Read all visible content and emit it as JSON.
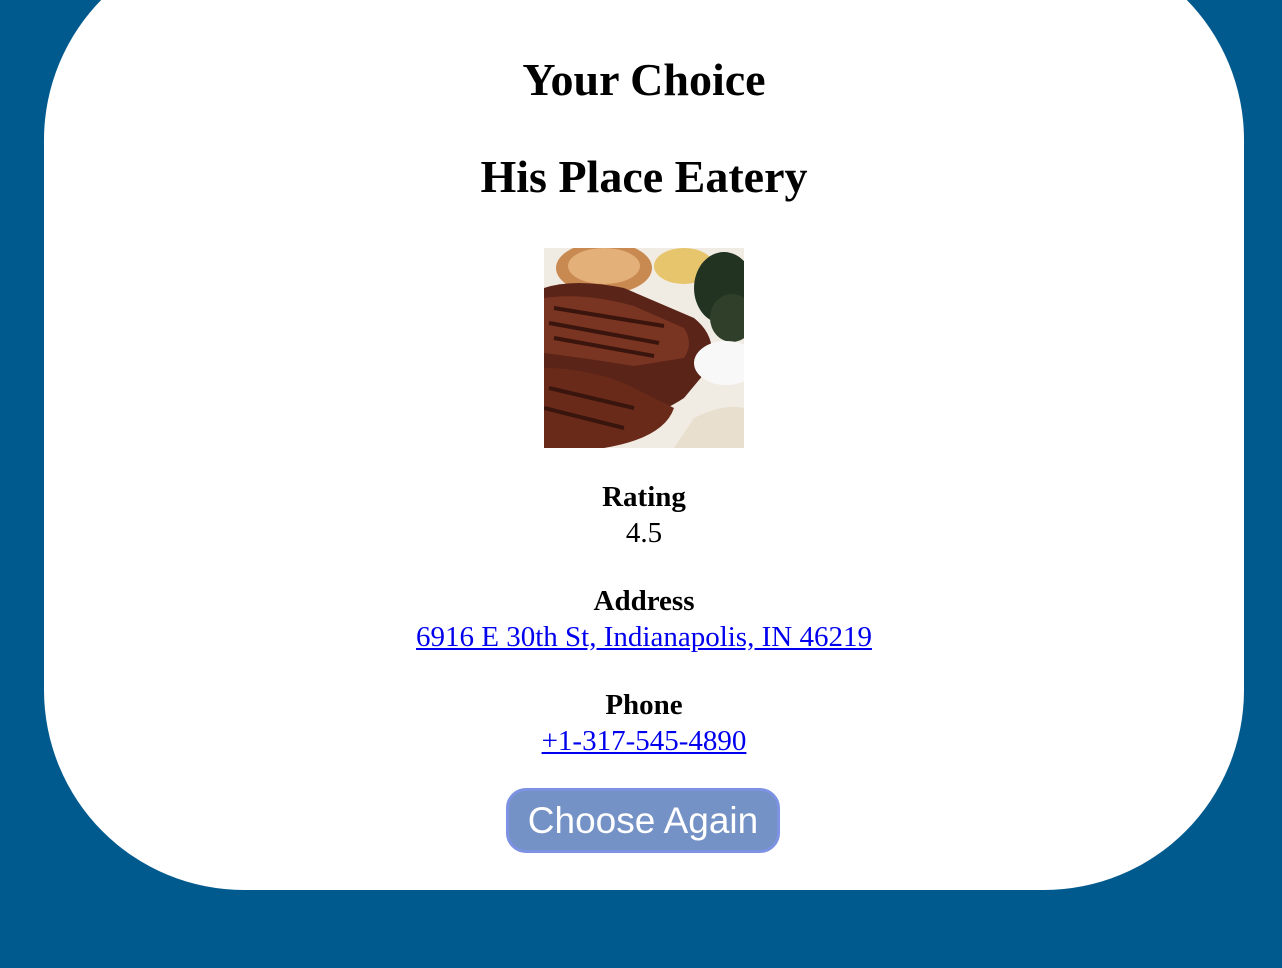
{
  "page": {
    "title": "Your Choice"
  },
  "restaurant": {
    "name": "His Place Eatery",
    "photo_subject": "ribs-plate",
    "rating_label": "Rating",
    "rating_value": "4.5",
    "address_label": "Address",
    "address_value": "6916 E 30th St, Indianapolis, IN 46219",
    "phone_label": "Phone",
    "phone_value": "+1-317-545-4890"
  },
  "actions": {
    "choose_again_label": "Choose Again"
  },
  "colors": {
    "background": "#005a8e",
    "card": "#ffffff",
    "link": "#0000ee",
    "button_fill": "#7592c6",
    "button_border": "#7d92e2"
  }
}
